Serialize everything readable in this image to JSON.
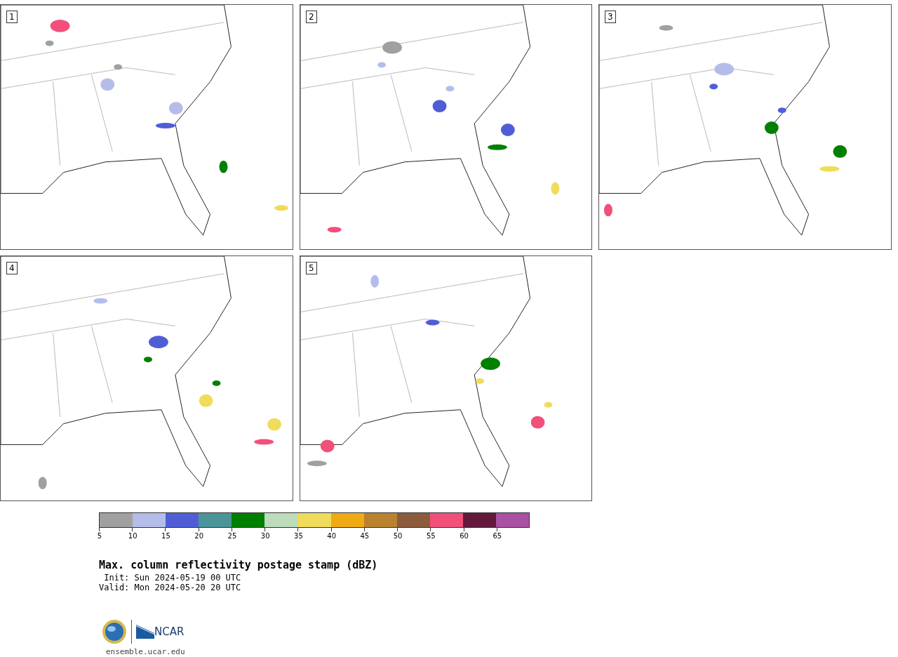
{
  "panels": [
    {
      "label": "1"
    },
    {
      "label": "2"
    },
    {
      "label": "3"
    },
    {
      "label": "4"
    },
    {
      "label": "5"
    }
  ],
  "legend": {
    "bins": [
      {
        "tick": "5",
        "color": "#a0a0a0"
      },
      {
        "tick": "10",
        "color": "#b4bdea"
      },
      {
        "tick": "15",
        "color": "#505ed6"
      },
      {
        "tick": "20",
        "color": "#4a9597"
      },
      {
        "tick": "25",
        "color": "#008000"
      },
      {
        "tick": "30",
        "color": "#bcdcbc"
      },
      {
        "tick": "35",
        "color": "#f0dc5a"
      },
      {
        "tick": "40",
        "color": "#f0aa14"
      },
      {
        "tick": "45",
        "color": "#b9822e"
      },
      {
        "tick": "50",
        "color": "#8c5a3c"
      },
      {
        "tick": "55",
        "color": "#f0507a"
      },
      {
        "tick": "60",
        "color": "#64183c"
      },
      {
        "tick": "65",
        "color": "#aa50a5"
      }
    ]
  },
  "title": "Max. column reflectivity postage stamp (dBZ)",
  "init": " Init: Sun 2024-05-19 00 UTC",
  "valid": "Valid: Mon 2024-05-20 20 UTC",
  "footer": {
    "logo_text": "NCAR",
    "url": "ensemble.ucar.edu"
  }
}
